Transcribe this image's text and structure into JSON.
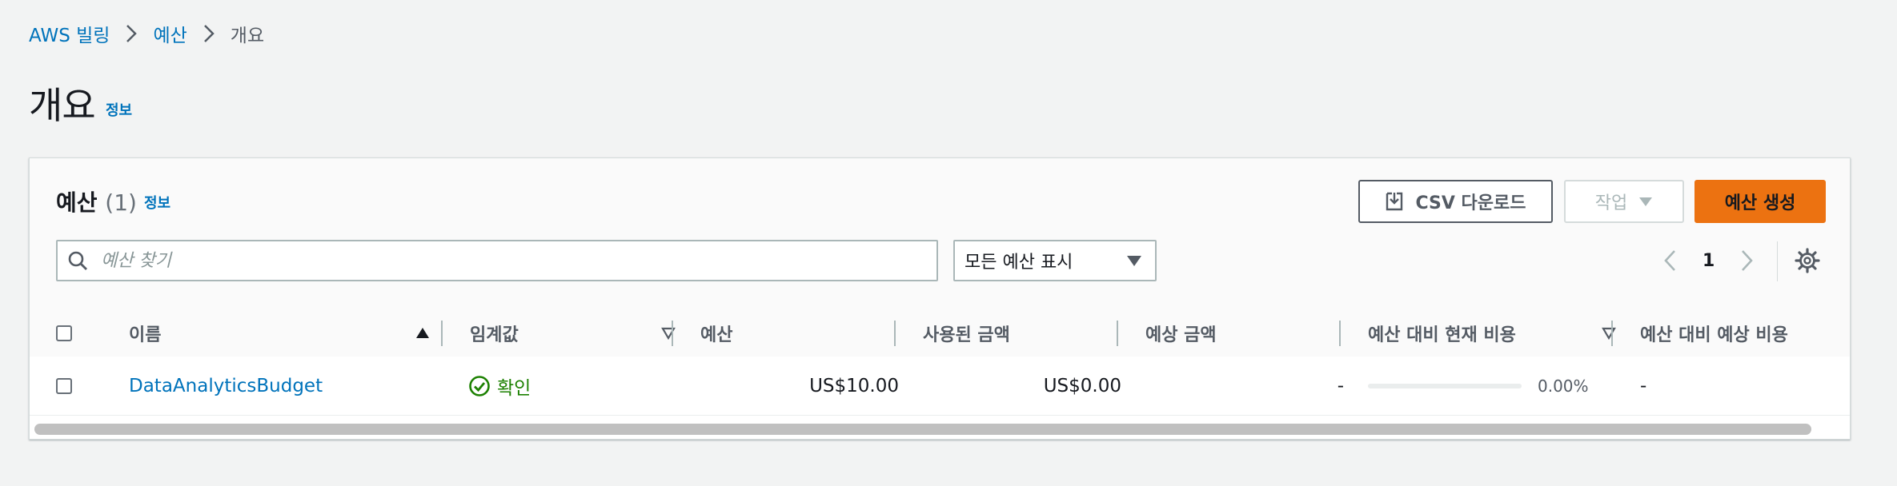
{
  "breadcrumb": {
    "items": [
      "AWS 빌링",
      "예산"
    ],
    "current": "개요"
  },
  "page": {
    "title": "개요",
    "info": "정보"
  },
  "budgets": {
    "title": "예산",
    "count": "(1)",
    "info": "정보",
    "buttons": {
      "csv": "CSV 다운로드",
      "action": "작업",
      "create": "예산 생성"
    },
    "search": {
      "placeholder": "예산 찾기",
      "value": ""
    },
    "filter": {
      "selected": "모든 예산 표시"
    },
    "pagination": {
      "current_page": "1"
    },
    "columns": [
      "이름",
      "임계값",
      "예산",
      "사용된 금액",
      "예상 금액",
      "예산 대비 현재 비용",
      "예산 대비 예상 비용"
    ],
    "rows": [
      {
        "name": "DataAnalyticsBudget",
        "threshold": "확인",
        "budget": "US$10.00",
        "used": "US$0.00",
        "forecast": "-",
        "current_vs_budget": "0.00%",
        "current_vs_budget_fraction": 0.0,
        "forecast_vs_budget": "-"
      }
    ]
  },
  "colors": {
    "link": "#0073bb",
    "primary_button": "#ec7211",
    "success": "#1d8102",
    "text": "#16191f",
    "muted": "#545b64",
    "background": "#f2f3f3"
  },
  "icons": [
    "chevron-right-icon",
    "download-icon",
    "caret-down-icon",
    "search-icon",
    "chevron-left-icon",
    "settings-icon",
    "sort-ascending-icon",
    "sort-icon",
    "status-ok-icon"
  ]
}
